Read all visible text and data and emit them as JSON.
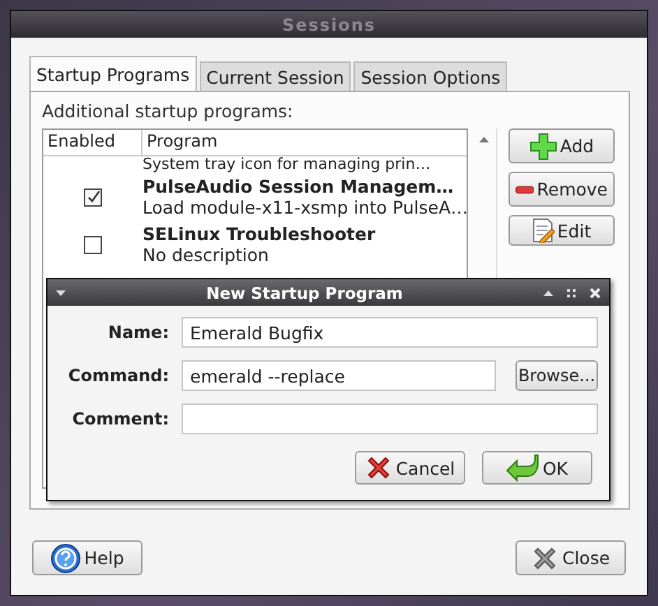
{
  "window": {
    "title": "Sessions"
  },
  "tabs": [
    {
      "label": "Startup Programs",
      "selected": true
    },
    {
      "label": "Current Session",
      "selected": false
    },
    {
      "label": "Session Options",
      "selected": false
    }
  ],
  "section_label": "Additional startup programs:",
  "list": {
    "columns": [
      "Enabled",
      "Program"
    ],
    "rows": [
      {
        "kind": "partial",
        "description": "System tray icon for managing prin…"
      },
      {
        "kind": "full",
        "checked": true,
        "name": "PulseAudio Session Managem…",
        "description": "Load module-x11-xsmp into PulseA…"
      },
      {
        "kind": "full",
        "checked": false,
        "name": "SELinux Troubleshooter",
        "description": "No description"
      }
    ]
  },
  "side_buttons": [
    {
      "kind": "add",
      "label": "Add"
    },
    {
      "kind": "remove",
      "label": "Remove"
    },
    {
      "kind": "edit",
      "label": "Edit"
    }
  ],
  "dialog": {
    "title": "New Startup Program",
    "fields": [
      {
        "label": "Name:",
        "value": "Emerald Bugfix"
      },
      {
        "label": "Command:",
        "value": "emerald --replace",
        "button": "Browse..."
      },
      {
        "label": "Comment:"
      }
    ],
    "buttons": [
      {
        "kind": "cancel",
        "label": "Cancel"
      },
      {
        "kind": "ok",
        "label": "OK"
      }
    ]
  },
  "bottom_buttons": [
    {
      "kind": "help",
      "label": "Help"
    },
    {
      "kind": "close",
      "label": "Close"
    }
  ]
}
